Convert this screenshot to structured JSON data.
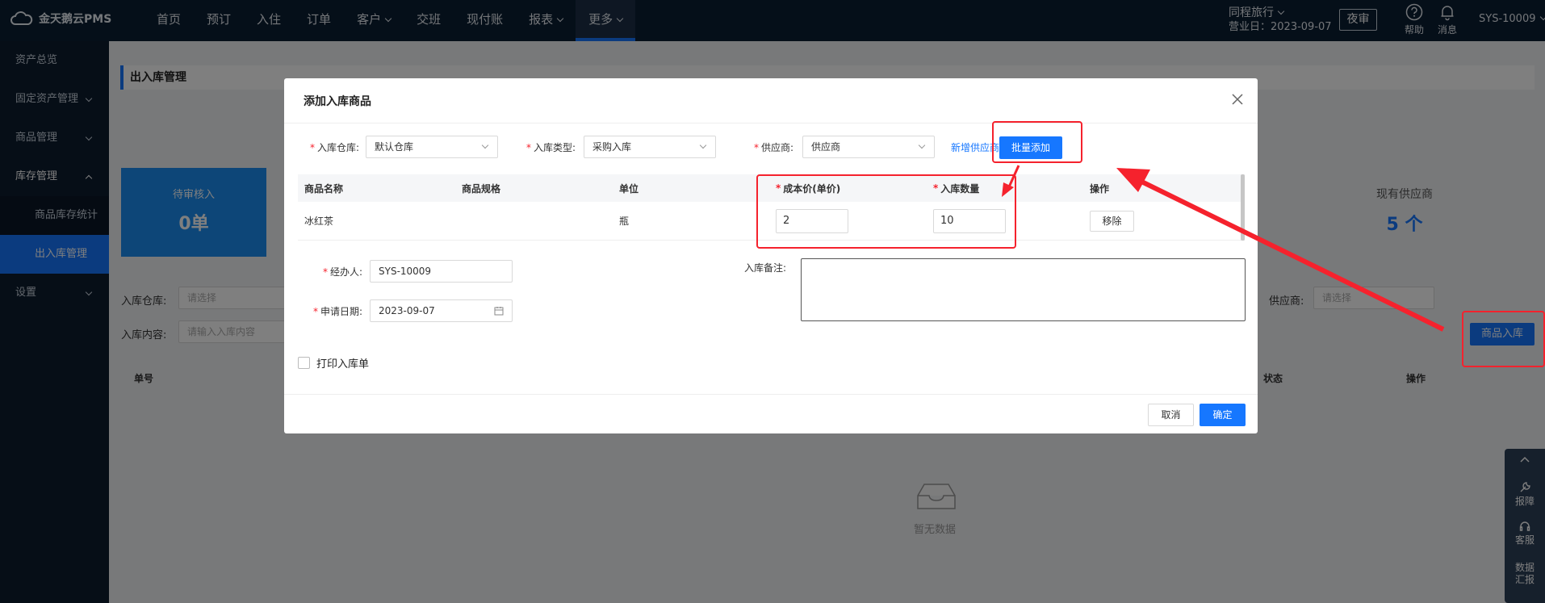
{
  "app": {
    "brand": "金天鹅云PMS"
  },
  "nav": {
    "items": [
      {
        "label": "首页"
      },
      {
        "label": "预订"
      },
      {
        "label": "入住"
      },
      {
        "label": "订单"
      },
      {
        "label": "客户"
      },
      {
        "label": "交班"
      },
      {
        "label": "现付账"
      },
      {
        "label": "报表"
      },
      {
        "label": "更多"
      }
    ],
    "hotel_name": "同程旅行",
    "business_date": "营业日：2023-09-07",
    "night_audit": "夜审",
    "help": "帮助",
    "messages": "消息",
    "user": "SYS-10009"
  },
  "sidebar": {
    "items": [
      {
        "label": "资产总览"
      },
      {
        "label": "固定资产管理"
      },
      {
        "label": "商品管理"
      },
      {
        "label": "库存管理"
      },
      {
        "label": "商品库存统计"
      },
      {
        "label": "出入库管理"
      },
      {
        "label": "设置"
      }
    ]
  },
  "page": {
    "title": "出入库管理",
    "pending_label": "待审核入",
    "pending_value": "0单",
    "supplier_label": "现有供应商",
    "supplier_value": "5 个",
    "filter_warehouse_label": "入库仓库:",
    "filter_warehouse_placeholder": "请选择",
    "filter_content_label": "入库内容:",
    "filter_content_placeholder": "请输入入库内容",
    "filter_supplier_label": "供应商:",
    "filter_supplier_placeholder": "请选择",
    "stock_in_button": "商品入库",
    "col_no": "单号",
    "col_status": "状态",
    "col_action": "操作",
    "empty": "暂无数据"
  },
  "floatbox": {
    "report": "报障",
    "service": "客服",
    "data": "数据汇报"
  },
  "modal": {
    "title": "添加入库商品",
    "warehouse_label": "入库仓库:",
    "warehouse_value": "默认仓库",
    "type_label": "入库类型:",
    "type_value": "采购入库",
    "supplier_label": "供应商:",
    "supplier_value": "供应商",
    "add_supplier_link": "新增供应商",
    "batch_add_button": "批量添加",
    "table": {
      "headers": [
        "商品名称",
        "商品规格",
        "单位",
        "成本价(单价)",
        "入库数量",
        "操作"
      ],
      "rows": [
        {
          "name": "冰红茶",
          "spec": "",
          "unit": "瓶",
          "cost": "2",
          "qty": "10",
          "action": "移除"
        }
      ]
    },
    "handler_label": "经办人:",
    "handler_value": "SYS-10009",
    "date_label": "申请日期:",
    "date_value": "2023-09-07",
    "remark_label": "入库备注:",
    "print_label": "打印入库单",
    "cancel": "取消",
    "confirm": "确定"
  },
  "colors": {
    "primary": "#1677ff",
    "nav_bg": "#0b1e33",
    "annotation": "#f5222d"
  }
}
